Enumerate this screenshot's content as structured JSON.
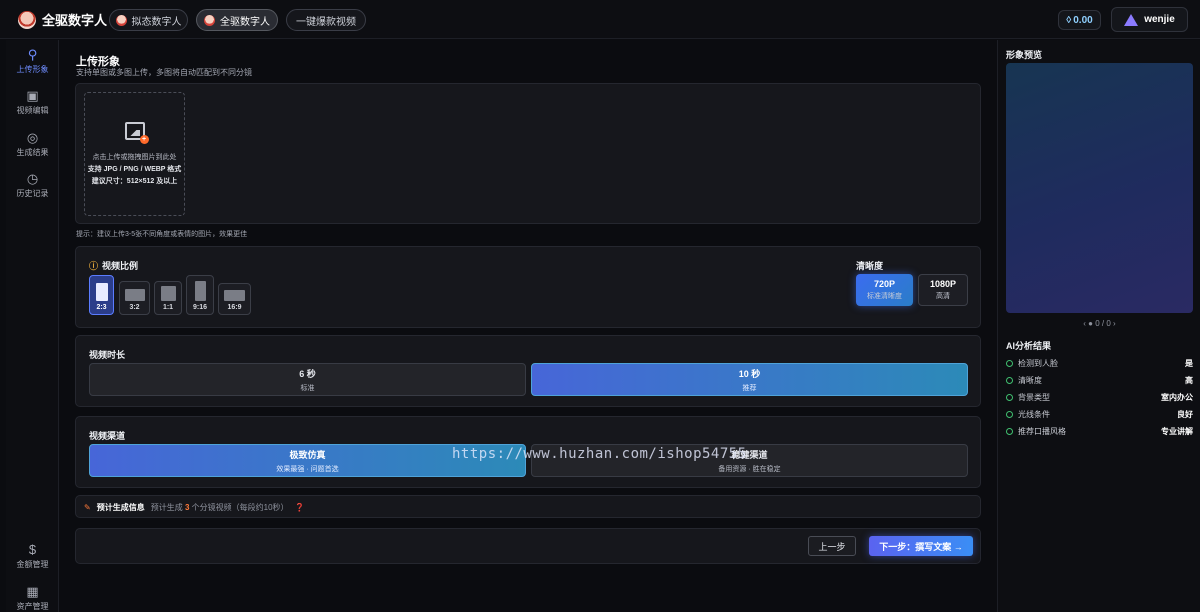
{
  "header": {
    "brand": "全驱数字人",
    "tabs": [
      {
        "label": "拟态数字人",
        "active": false
      },
      {
        "label": "全驱数字人",
        "active": true
      },
      {
        "label": "一键爆款视频",
        "active": false
      }
    ],
    "balance": "0.00",
    "username": "wenjie"
  },
  "sidebar": {
    "items": [
      {
        "label": "上传形象",
        "icon": "user-icon",
        "active": true
      },
      {
        "label": "视频编辑",
        "icon": "video-edit-icon",
        "active": false
      },
      {
        "label": "生成结果",
        "icon": "check-circle-icon",
        "active": false
      },
      {
        "label": "历史记录",
        "icon": "clock-icon",
        "active": false
      }
    ],
    "bottom_items": [
      {
        "label": "金额管理",
        "icon": "dollar-icon"
      },
      {
        "label": "资产管理",
        "icon": "grid-icon"
      }
    ]
  },
  "upload": {
    "title": "上传形象",
    "subtitle": "支持单图或多图上传，多图将自动匹配到不同分镜",
    "box_line1": "点击上传或拖拽图片到此处",
    "box_line2": "支持 JPG / PNG / WEBP 格式",
    "box_line3": "建议尺寸：512×512 及以上",
    "tip": "提示：建议上传3-5张不同角度或表情的图片，效果更佳"
  },
  "ratio": {
    "label": "视频比例",
    "options": [
      {
        "label": "2:3",
        "active": true
      },
      {
        "label": "3:2",
        "active": false
      },
      {
        "label": "1:1",
        "active": false
      },
      {
        "label": "9:16",
        "active": false
      },
      {
        "label": "16:9",
        "active": false
      }
    ]
  },
  "resolution": {
    "label": "清晰度",
    "options": [
      {
        "label": "720P",
        "sub": "标准清晰度",
        "active": true
      },
      {
        "label": "1080P",
        "sub": "高清",
        "active": false
      }
    ]
  },
  "duration": {
    "label": "视频时长",
    "options": [
      {
        "label": "6 秒",
        "sub": "标准",
        "active": false
      },
      {
        "label": "10 秒",
        "sub": "推荐",
        "active": true
      }
    ]
  },
  "channel": {
    "label": "视频渠道",
    "options": [
      {
        "label": "极致仿真",
        "sub": "效果最强 · 问题首选",
        "active": true
      },
      {
        "label": "稳健渠道",
        "sub": "备用资源 · 胜在稳定",
        "active": false
      }
    ]
  },
  "generate_info": {
    "title": "预计生成信息",
    "desc_prefix": "预计生成",
    "count": "3",
    "desc_suffix": "个分镜视频（每段约10秒）"
  },
  "actions": {
    "prev": "上一步",
    "next": "下一步：撰写文案 →"
  },
  "preview": {
    "title": "形象预览",
    "pager": "‹   ● 0 / 0   ›"
  },
  "ai": {
    "title": "AI分析结果",
    "rows": [
      {
        "label": "检测到人脸",
        "value": "是"
      },
      {
        "label": "清晰度",
        "value": "高"
      },
      {
        "label": "背景类型",
        "value": "室内办公"
      },
      {
        "label": "光线条件",
        "value": "良好"
      },
      {
        "label": "推荐口播风格",
        "value": "专业讲解"
      }
    ]
  },
  "watermark": "https://www.huzhan.com/ishop54755",
  "colors": {
    "accent": "#4766d8",
    "highlight": "#ff7a3a"
  }
}
